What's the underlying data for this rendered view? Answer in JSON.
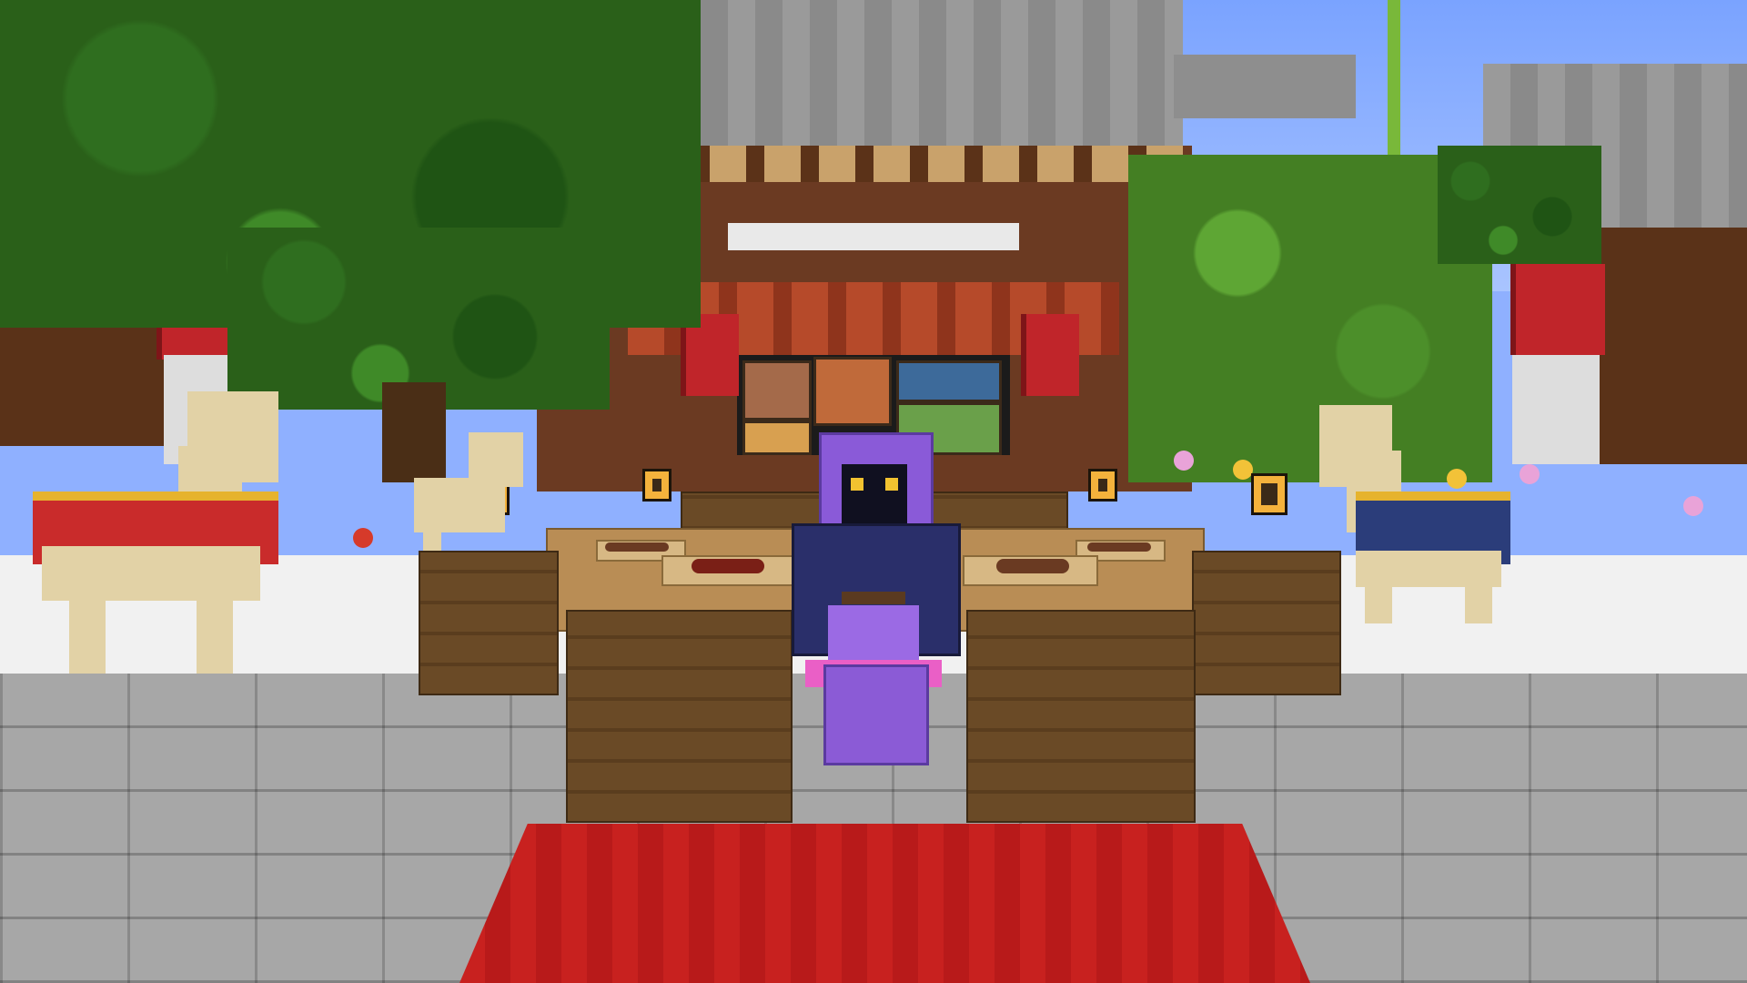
{
  "scene": {
    "title": "",
    "description_colors": {
      "sky": "#8fb0ff",
      "roof": "#8e8e8e",
      "temple_wood": "#6b3a22",
      "red_pillar": "#c0252a",
      "carpet": "#c8211f",
      "player_purple": "#8a5ad8",
      "player_coat": "#2a2f6a",
      "floor_stone": "#a7a7a7",
      "snow": "#f1f1f1"
    }
  },
  "icons": {
    "player": "player-avatar-icon",
    "llama_red": "llama-red-rug-icon",
    "llama_blue": "llama-blue-rug-icon",
    "steak": "steak-icon",
    "lantern": "lantern-icon"
  }
}
